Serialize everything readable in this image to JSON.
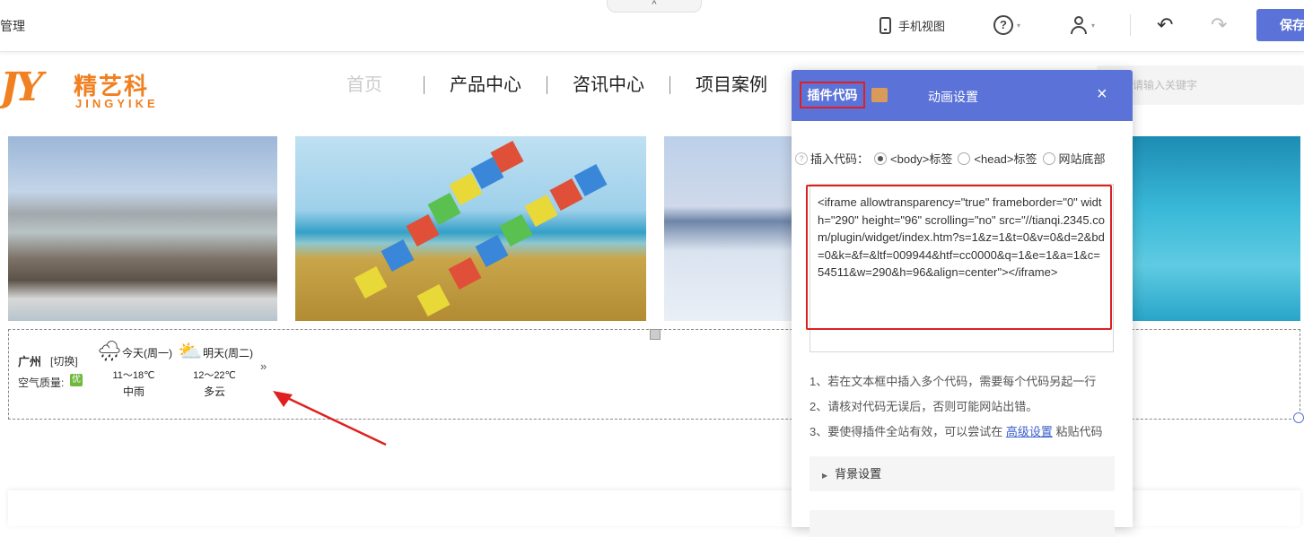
{
  "toolbar": {
    "collapse_icon": "^",
    "manage_label": "管理",
    "mobile_view_label": "手机视图",
    "help_icon_text": "?",
    "caret": "▾",
    "undo_icon": "↶",
    "redo_icon": "↷",
    "save_label": "保存"
  },
  "site": {
    "logo_mark": "JY",
    "logo_cn": "精艺科",
    "logo_en": "JINGYIKE",
    "nav": [
      "首页",
      "产品中心",
      "咨讯中心",
      "项目案例"
    ],
    "search_placeholder": "请输入关键字"
  },
  "weather": {
    "city": "广州",
    "switch_label": "[切换]",
    "air_quality_label": "空气质量:",
    "air_quality_value": "优",
    "days": [
      {
        "name": "今天(周一)",
        "temp": "11～18℃",
        "condition": "中雨",
        "icon": "cloud-rain-icon",
        "glyph": "🌧"
      },
      {
        "name": "明天(周二)",
        "temp": "12～22℃",
        "condition": "多云",
        "icon": "partly-cloudy-icon",
        "glyph": "⛅"
      }
    ],
    "more": "»"
  },
  "dialog": {
    "tab_plugin": "插件代码",
    "tab_animation": "动画设置",
    "close": "×",
    "insert_label": "插入代码：",
    "options": [
      "<body>标签",
      "<head>标签",
      "网站底部"
    ],
    "selected_option": "<body>标签",
    "code": "<iframe allowtransparency=\"true\" frameborder=\"0\" width=\"290\" height=\"96\" scrolling=\"no\" src=\"//tianqi.2345.com/plugin/widget/index.htm?s=1&z=1&t=0&v=0&d=2&bd=0&k=&f=&ltf=009944&htf=cc0000&q=1&e=1&a=1&c=54511&w=290&h=96&align=center\"></iframe>",
    "tips": [
      "1、若在文本框中插入多个代码，需要每个代码另起一行",
      "2、请核对代码无误后，否则可能网站出错。"
    ],
    "tip3_prefix": "3、要使得插件全站有效，可以尝试在 ",
    "tip3_link": "高级设置",
    "tip3_suffix": " 粘贴代码",
    "bg_settings_label": "背景设置"
  },
  "colors": {
    "accent": "#5b73d8",
    "highlight_red": "#e02020",
    "logo_orange": "#f08020"
  }
}
